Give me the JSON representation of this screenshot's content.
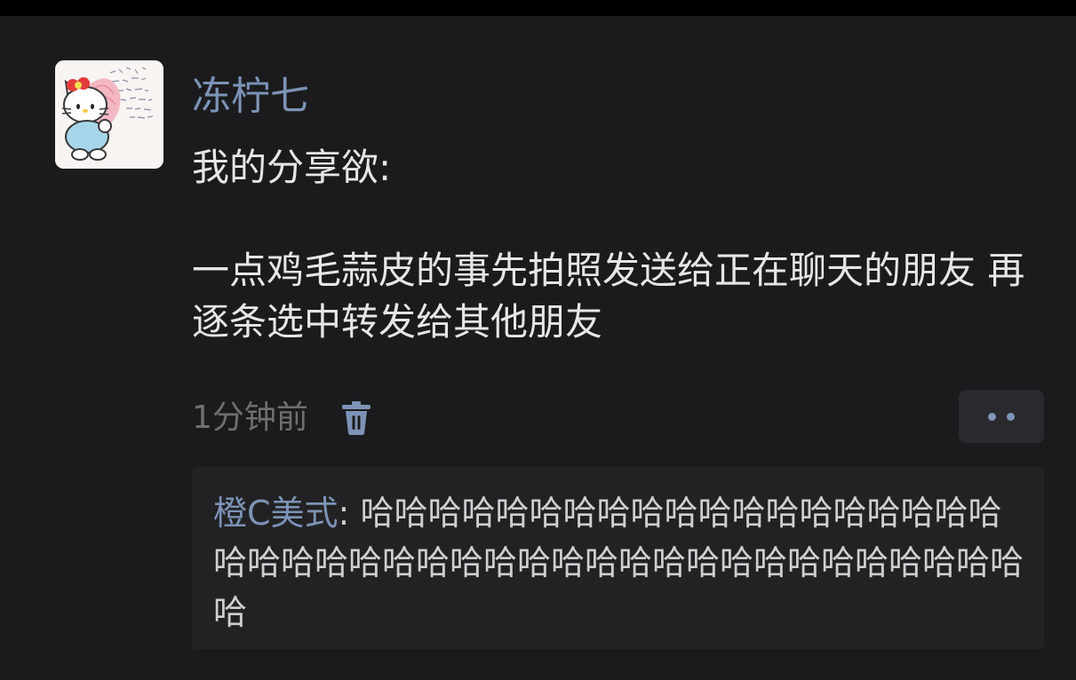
{
  "post": {
    "username": "冻柠七",
    "content_line1": "我的分享欲:",
    "content_line2": "一点鸡毛蒜皮的事先拍照发送给正在聊天的朋友 再逐条选中转发给其他朋友",
    "time": "1分钟前",
    "delete_icon": "trash-icon",
    "more_icon": "more-dots-icon"
  },
  "comments": [
    {
      "author": "橙C美式",
      "separator": ": ",
      "text": "哈哈哈哈哈哈哈哈哈哈哈哈哈哈哈哈哈哈哈哈哈哈哈哈哈哈哈哈哈哈哈哈哈哈哈哈哈哈哈哈哈哈哈哈"
    }
  ],
  "colors": {
    "background": "#1b1b1d",
    "username": "#7d93b6",
    "text": "#e6e6e6",
    "muted": "#6f6f72",
    "comment_bg": "#222224"
  }
}
